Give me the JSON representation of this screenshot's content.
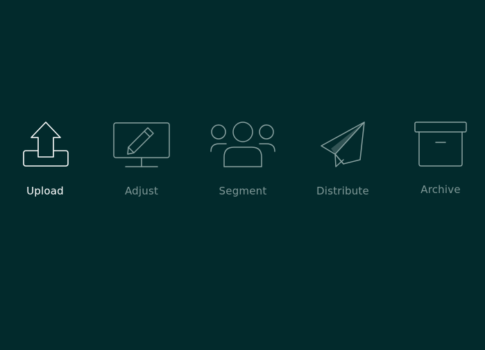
{
  "steps": [
    {
      "label": "Upload",
      "icon": "upload-icon",
      "active": true
    },
    {
      "label": "Adjust",
      "icon": "monitor-pencil-icon",
      "active": false
    },
    {
      "label": "Segment",
      "icon": "users-group-icon",
      "active": false
    },
    {
      "label": "Distribute",
      "icon": "paper-plane-icon",
      "active": false
    },
    {
      "label": "Archive",
      "icon": "archive-box-icon",
      "active": false
    }
  ],
  "colors": {
    "background": "#022a2c",
    "active": "#ffffff",
    "inactive_icon": "#8ba3a2",
    "inactive_text": "#7f9897"
  }
}
